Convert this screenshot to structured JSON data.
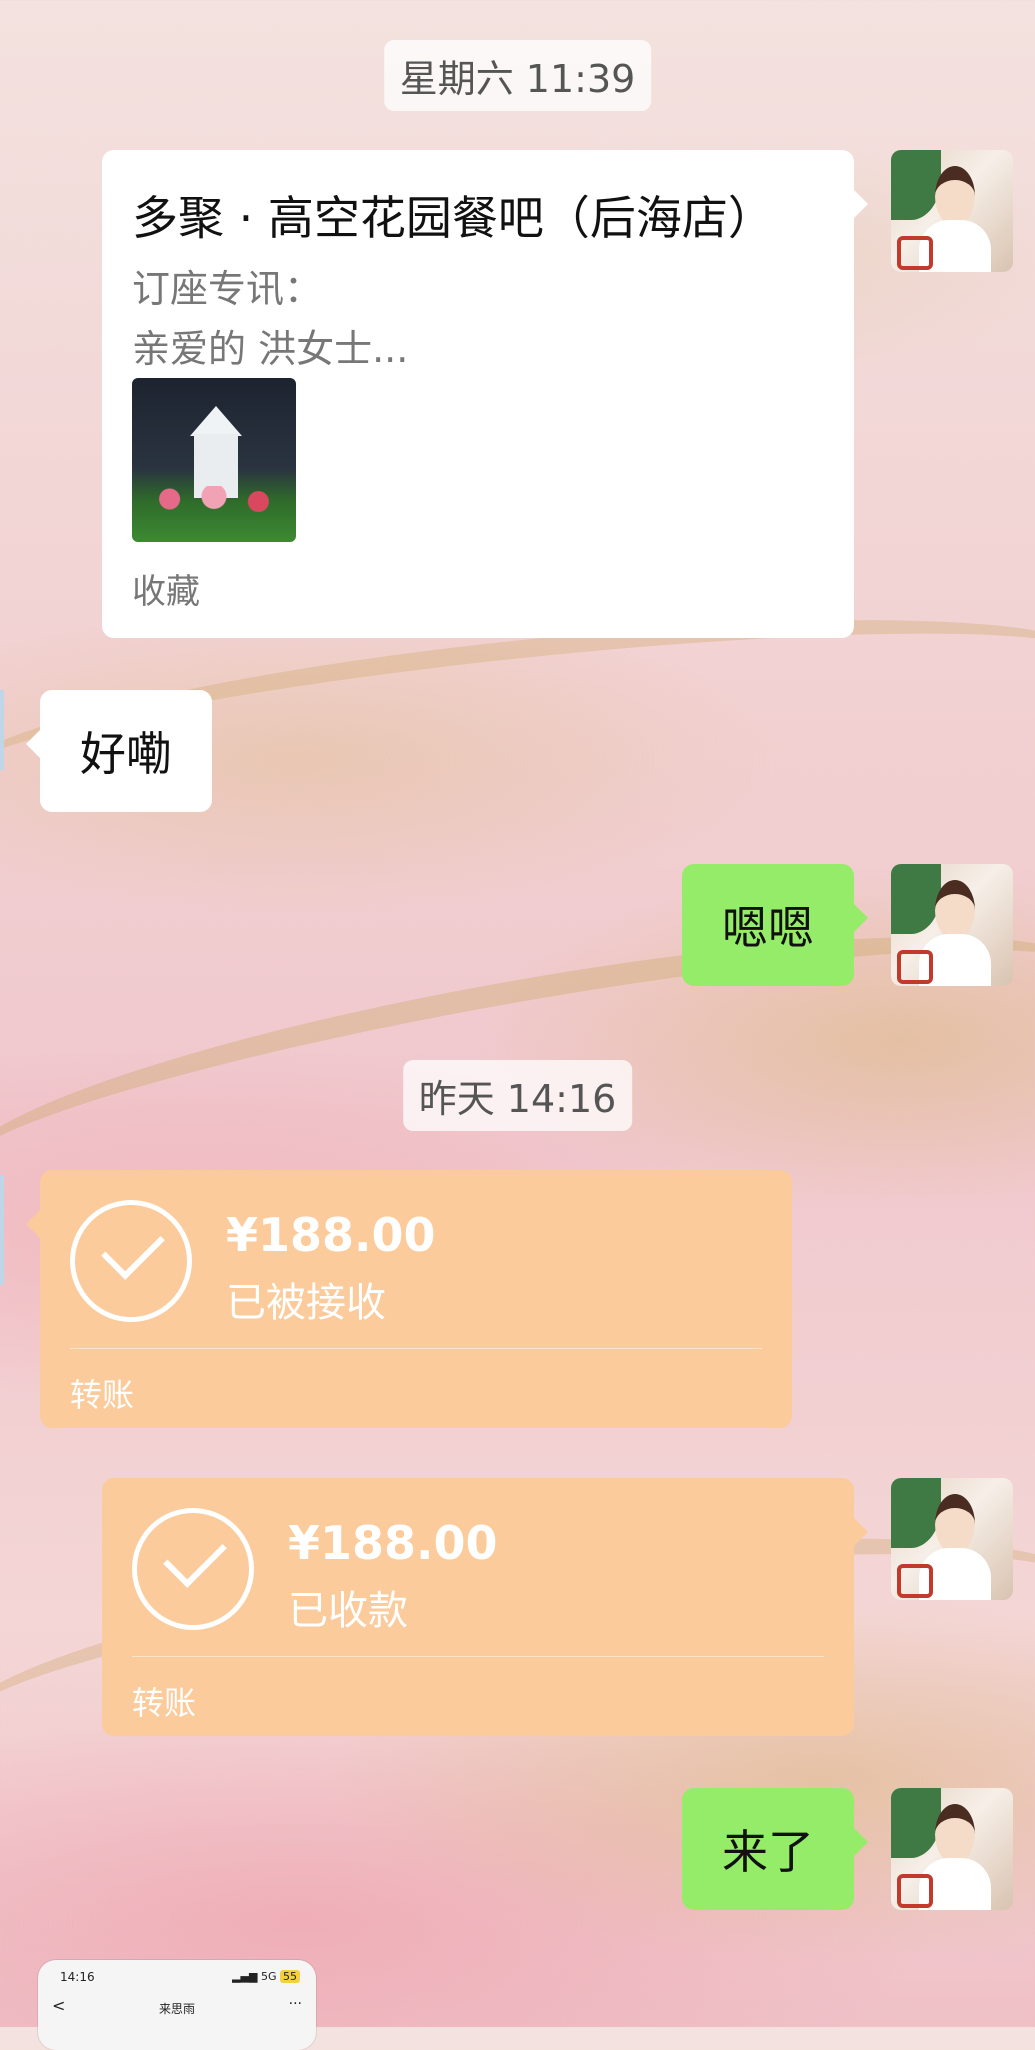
{
  "chat": {
    "timestamps": [
      "星期六 11:39",
      "昨天 14:16"
    ],
    "card": {
      "title": "多聚 · 高空花园餐吧（后海店）",
      "subtitle": "订座专讯：",
      "preview": "亲爱的 洪女士...",
      "footer": "收藏"
    },
    "messages": {
      "left_reply": "好嘞",
      "right_reply": "嗯嗯",
      "last": "来了"
    },
    "transfers": [
      {
        "amount": "¥188.00",
        "status": "已被接收",
        "label": "转账"
      },
      {
        "amount": "¥188.00",
        "status": "已收款",
        "label": "转账"
      }
    ]
  },
  "mini_screenshot": {
    "time": "14:16",
    "status": "5G",
    "battery": "55",
    "back": "<",
    "title": "来思雨",
    "more": "···"
  }
}
